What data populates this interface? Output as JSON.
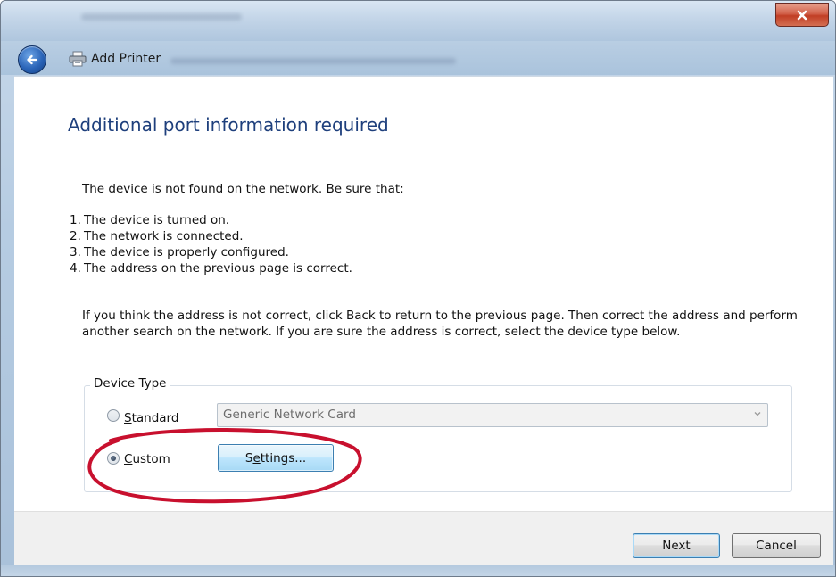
{
  "window": {
    "title": "Add Printer"
  },
  "page": {
    "heading": "Additional port information required",
    "intro": "The device is not found on the network.  Be sure that:",
    "checklist": [
      {
        "num": "1.",
        "text": "The device is turned on."
      },
      {
        "num": "2.",
        "text": "The network is connected."
      },
      {
        "num": "3.",
        "text": "The device is properly configured."
      },
      {
        "num": "4.",
        "text": "The address on the previous page is correct."
      }
    ],
    "explanation": "If you think the address is not correct, click Back to return to the previous page.  Then correct the address and perform another search on the network.  If you are sure the address is correct, select the device type below."
  },
  "device_type": {
    "legend": "Device Type",
    "standard": {
      "label_prefix": "",
      "accesskey": "S",
      "label_rest": "tandard",
      "selected": false
    },
    "standard_combo_value": "Generic Network Card",
    "custom": {
      "accesskey": "C",
      "label_rest": "ustom",
      "selected": true
    },
    "settings_button": {
      "before": "S",
      "accesskey": "e",
      "after": "ttings..."
    }
  },
  "footer": {
    "next_label": "Next",
    "cancel_label": "Cancel"
  },
  "annotation": {
    "color": "#c8102e"
  },
  "colors": {
    "heading": "#1e3f7c",
    "button_focus": "#3c7fb1"
  },
  "icons": [
    "close-icon",
    "back-arrow-icon",
    "printer-icon",
    "chevron-down-icon"
  ]
}
